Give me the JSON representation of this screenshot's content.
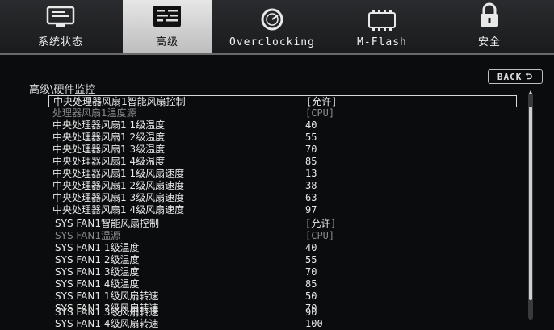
{
  "tabs": [
    {
      "label": "系统状态",
      "icon": "monitor-icon",
      "active": false
    },
    {
      "label": "高级",
      "icon": "settings-panel-icon",
      "active": true
    },
    {
      "label": "Overclocking",
      "icon": "gauge-icon",
      "active": false
    },
    {
      "label": "M-Flash",
      "icon": "bios-chip-icon",
      "active": false
    },
    {
      "label": "安全",
      "icon": "lock-icon",
      "active": false
    }
  ],
  "breadcrumb": "高级\\硬件监控",
  "back_button": {
    "label": "BACK"
  },
  "rows": [
    {
      "label": "中央处理器风扇1智能风扇控制",
      "value": "[允许]",
      "state": "selected"
    },
    {
      "label": "处理器风扇1温度源",
      "value": "[CPU]",
      "state": "dim"
    },
    {
      "label": "中央处理器风扇1 1级温度",
      "value": "40",
      "state": "normal"
    },
    {
      "label": "中央处理器风扇1 2级温度",
      "value": "55",
      "state": "normal"
    },
    {
      "label": "中央处理器风扇1 3级温度",
      "value": "70",
      "state": "normal"
    },
    {
      "label": "中央处理器风扇1 4级温度",
      "value": "85",
      "state": "normal"
    },
    {
      "label": "中央处理器风扇1 1级风扇速度",
      "value": "13",
      "state": "normal"
    },
    {
      "label": "中央处理器风扇1 2级风扇速度",
      "value": "38",
      "state": "normal"
    },
    {
      "label": "中央处理器风扇1 3级风扇速度",
      "value": "63",
      "state": "normal"
    },
    {
      "label": "中央处理器风扇1 4级风扇速度",
      "value": "97",
      "state": "normal"
    },
    {
      "label": "SYS FAN1智能风扇控制",
      "value": "[允许]",
      "state": "normal"
    },
    {
      "label": "SYS FAN1温源",
      "value": "[CPU]",
      "state": "dim"
    },
    {
      "label": "SYS FAN1 1级温度",
      "value": "40",
      "state": "normal"
    },
    {
      "label": "SYS FAN1 2级温度",
      "value": "55",
      "state": "normal"
    },
    {
      "label": "SYS FAN1 3级温度",
      "value": "70",
      "state": "normal"
    },
    {
      "label": "SYS FAN1 4级温度",
      "value": "85",
      "state": "normal"
    },
    {
      "label": "SYS FAN1 1级风扇转速",
      "value": "50",
      "state": "normal"
    },
    {
      "label": "SYS FAN1 2级风扇转速",
      "value": "70",
      "state": "normal"
    },
    {
      "label": "SYS FAN1 3级风扇转速",
      "value": "90",
      "state": "normal"
    },
    {
      "label": "SYS FAN1 4级风扇转速",
      "value": "100",
      "state": "normal"
    }
  ]
}
